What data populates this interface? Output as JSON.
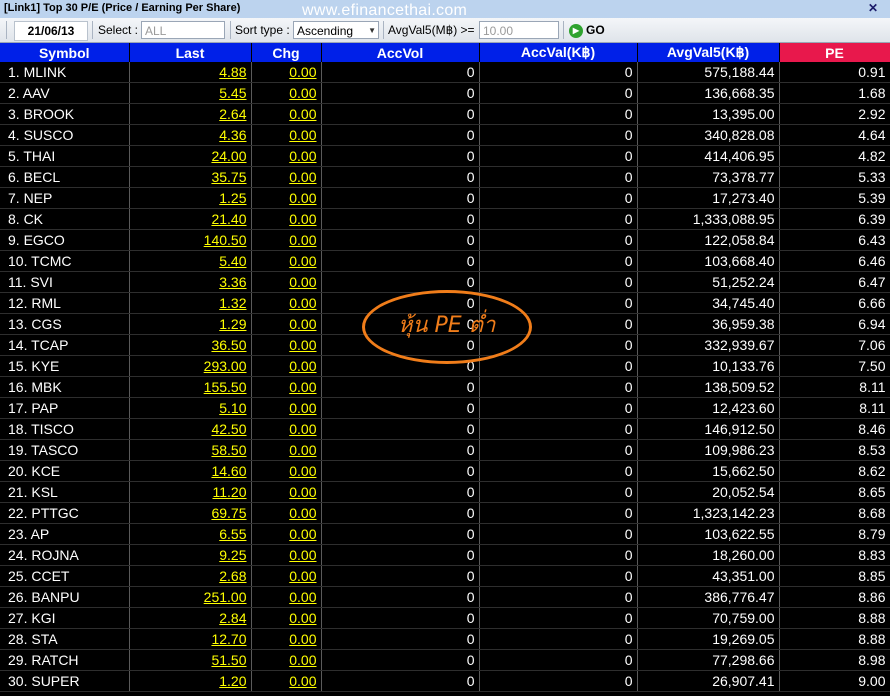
{
  "window": {
    "title": "[Link1] Top 30 P/E (Price / Earning Per Share)",
    "watermark": "www.efinancethai.com",
    "close_glyph": "✕"
  },
  "toolbar": {
    "date": "21/06/13",
    "select_label": "Select :",
    "select_value": "ALL",
    "sort_label": "Sort type :",
    "sort_value": "Ascending",
    "avgval_label": "AvgVal5(M฿) >=",
    "avgval_value": "10.00",
    "go_label": "GO",
    "go_icon": "play-circle-icon"
  },
  "columns": [
    "Symbol",
    "Last",
    "Chg",
    "AccVol",
    "AccVal(K฿)",
    "AvgVal5(K฿)",
    "PE"
  ],
  "highlight_column_color": "#e8184c",
  "header_color": "#0020e8",
  "rows": [
    {
      "symbol": "1. MLINK",
      "last": "4.88",
      "chg": "0.00",
      "accvol": "0",
      "accval": "0",
      "avgval5": "575,188.44",
      "pe": "0.91"
    },
    {
      "symbol": "2. AAV",
      "last": "5.45",
      "chg": "0.00",
      "accvol": "0",
      "accval": "0",
      "avgval5": "136,668.35",
      "pe": "1.68"
    },
    {
      "symbol": "3. BROOK",
      "last": "2.64",
      "chg": "0.00",
      "accvol": "0",
      "accval": "0",
      "avgval5": "13,395.00",
      "pe": "2.92"
    },
    {
      "symbol": "4. SUSCO",
      "last": "4.36",
      "chg": "0.00",
      "accvol": "0",
      "accval": "0",
      "avgval5": "340,828.08",
      "pe": "4.64"
    },
    {
      "symbol": "5. THAI",
      "last": "24.00",
      "chg": "0.00",
      "accvol": "0",
      "accval": "0",
      "avgval5": "414,406.95",
      "pe": "4.82"
    },
    {
      "symbol": "6. BECL",
      "last": "35.75",
      "chg": "0.00",
      "accvol": "0",
      "accval": "0",
      "avgval5": "73,378.77",
      "pe": "5.33"
    },
    {
      "symbol": "7. NEP",
      "last": "1.25",
      "chg": "0.00",
      "accvol": "0",
      "accval": "0",
      "avgval5": "17,273.40",
      "pe": "5.39"
    },
    {
      "symbol": "8. CK",
      "last": "21.40",
      "chg": "0.00",
      "accvol": "0",
      "accval": "0",
      "avgval5": "1,333,088.95",
      "pe": "6.39"
    },
    {
      "symbol": "9. EGCO",
      "last": "140.50",
      "chg": "0.00",
      "accvol": "0",
      "accval": "0",
      "avgval5": "122,058.84",
      "pe": "6.43"
    },
    {
      "symbol": "10. TCMC",
      "last": "5.40",
      "chg": "0.00",
      "accvol": "0",
      "accval": "0",
      "avgval5": "103,668.40",
      "pe": "6.46"
    },
    {
      "symbol": "11. SVI",
      "last": "3.36",
      "chg": "0.00",
      "accvol": "0",
      "accval": "0",
      "avgval5": "51,252.24",
      "pe": "6.47"
    },
    {
      "symbol": "12. RML",
      "last": "1.32",
      "chg": "0.00",
      "accvol": "0",
      "accval": "0",
      "avgval5": "34,745.40",
      "pe": "6.66"
    },
    {
      "symbol": "13. CGS",
      "last": "1.29",
      "chg": "0.00",
      "accvol": "0",
      "accval": "0",
      "avgval5": "36,959.38",
      "pe": "6.94"
    },
    {
      "symbol": "14. TCAP",
      "last": "36.50",
      "chg": "0.00",
      "accvol": "0",
      "accval": "0",
      "avgval5": "332,939.67",
      "pe": "7.06"
    },
    {
      "symbol": "15. KYE",
      "last": "293.00",
      "chg": "0.00",
      "accvol": "0",
      "accval": "0",
      "avgval5": "10,133.76",
      "pe": "7.50"
    },
    {
      "symbol": "16. MBK",
      "last": "155.50",
      "chg": "0.00",
      "accvol": "0",
      "accval": "0",
      "avgval5": "138,509.52",
      "pe": "8.11"
    },
    {
      "symbol": "17. PAP",
      "last": "5.10",
      "chg": "0.00",
      "accvol": "0",
      "accval": "0",
      "avgval5": "12,423.60",
      "pe": "8.11"
    },
    {
      "symbol": "18. TISCO",
      "last": "42.50",
      "chg": "0.00",
      "accvol": "0",
      "accval": "0",
      "avgval5": "146,912.50",
      "pe": "8.46"
    },
    {
      "symbol": "19. TASCO",
      "last": "58.50",
      "chg": "0.00",
      "accvol": "0",
      "accval": "0",
      "avgval5": "109,986.23",
      "pe": "8.53"
    },
    {
      "symbol": "20. KCE",
      "last": "14.60",
      "chg": "0.00",
      "accvol": "0",
      "accval": "0",
      "avgval5": "15,662.50",
      "pe": "8.62"
    },
    {
      "symbol": "21. KSL",
      "last": "11.20",
      "chg": "0.00",
      "accvol": "0",
      "accval": "0",
      "avgval5": "20,052.54",
      "pe": "8.65"
    },
    {
      "symbol": "22. PTTGC",
      "last": "69.75",
      "chg": "0.00",
      "accvol": "0",
      "accval": "0",
      "avgval5": "1,323,142.23",
      "pe": "8.68"
    },
    {
      "symbol": "23. AP",
      "last": "6.55",
      "chg": "0.00",
      "accvol": "0",
      "accval": "0",
      "avgval5": "103,622.55",
      "pe": "8.79"
    },
    {
      "symbol": "24. ROJNA",
      "last": "9.25",
      "chg": "0.00",
      "accvol": "0",
      "accval": "0",
      "avgval5": "18,260.00",
      "pe": "8.83"
    },
    {
      "symbol": "25. CCET",
      "last": "2.68",
      "chg": "0.00",
      "accvol": "0",
      "accval": "0",
      "avgval5": "43,351.00",
      "pe": "8.85"
    },
    {
      "symbol": "26. BANPU",
      "last": "251.00",
      "chg": "0.00",
      "accvol": "0",
      "accval": "0",
      "avgval5": "386,776.47",
      "pe": "8.86"
    },
    {
      "symbol": "27. KGI",
      "last": "2.84",
      "chg": "0.00",
      "accvol": "0",
      "accval": "0",
      "avgval5": "70,759.00",
      "pe": "8.88"
    },
    {
      "symbol": "28. STA",
      "last": "12.70",
      "chg": "0.00",
      "accvol": "0",
      "accval": "0",
      "avgval5": "19,269.05",
      "pe": "8.88"
    },
    {
      "symbol": "29. RATCH",
      "last": "51.50",
      "chg": "0.00",
      "accvol": "0",
      "accval": "0",
      "avgval5": "77,298.66",
      "pe": "8.98"
    },
    {
      "symbol": "30. SUPER",
      "last": "1.20",
      "chg": "0.00",
      "accvol": "0",
      "accval": "0",
      "avgval5": "26,907.41",
      "pe": "9.00"
    }
  ],
  "annotation": {
    "text": "หุ้น PE ต่ำ",
    "color": "#f07d1a"
  }
}
